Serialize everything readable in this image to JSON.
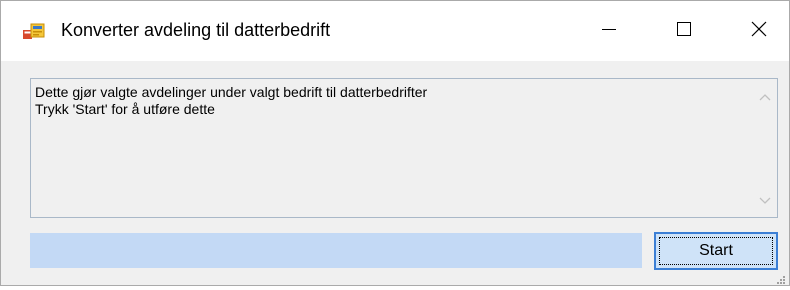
{
  "window": {
    "title": "Konverter avdeling til datterbedrift",
    "icon": "app-forms-icon"
  },
  "caption_buttons": {
    "minimize": "minimize-icon",
    "maximize": "maximize-icon",
    "close": "close-icon"
  },
  "message": {
    "text": "Dette gjør valgte avdelinger under valgt bedrift til datterbedrifter\nTrykk 'Start' for å utføre dette"
  },
  "progress": {
    "value": 0
  },
  "actions": {
    "start_label": "Start"
  },
  "colors": {
    "progress_fill": "#c3d9f5",
    "button_border": "#3c7fd5",
    "button_fill": "#cfe3f8"
  }
}
